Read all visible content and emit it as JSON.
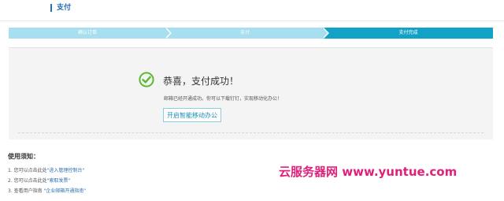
{
  "header": {
    "title": "支付"
  },
  "steps": [
    {
      "label": "确认订单",
      "state": "done"
    },
    {
      "label": "支付",
      "state": "done"
    },
    {
      "label": "支付完成",
      "state": "active"
    }
  ],
  "success": {
    "icon": "check-circle-icon",
    "title": "恭喜，支付成功！",
    "description": "邮箱已经开通成功。你可以下载钉钉，实现移动化办公！",
    "button_label": "开启智能移动办公"
  },
  "notes": {
    "title": "使用须知：",
    "items": [
      {
        "prefix": "1. 您可以点击此处",
        "link": "\"进入管理控制台\""
      },
      {
        "prefix": "2. 您可以点击此处",
        "link": "\"索取发票\""
      },
      {
        "prefix": "3. 查看用户指南 ",
        "link": "\"企业邮箱开通指南\""
      }
    ]
  },
  "watermark": "云服务器网 www.yuntue.com",
  "colors": {
    "accent": "#13a2c7",
    "step_done": "#a8dff0",
    "success_green": "#5cb82e",
    "link": "#2a6fb0",
    "watermark": "#e0217a"
  }
}
